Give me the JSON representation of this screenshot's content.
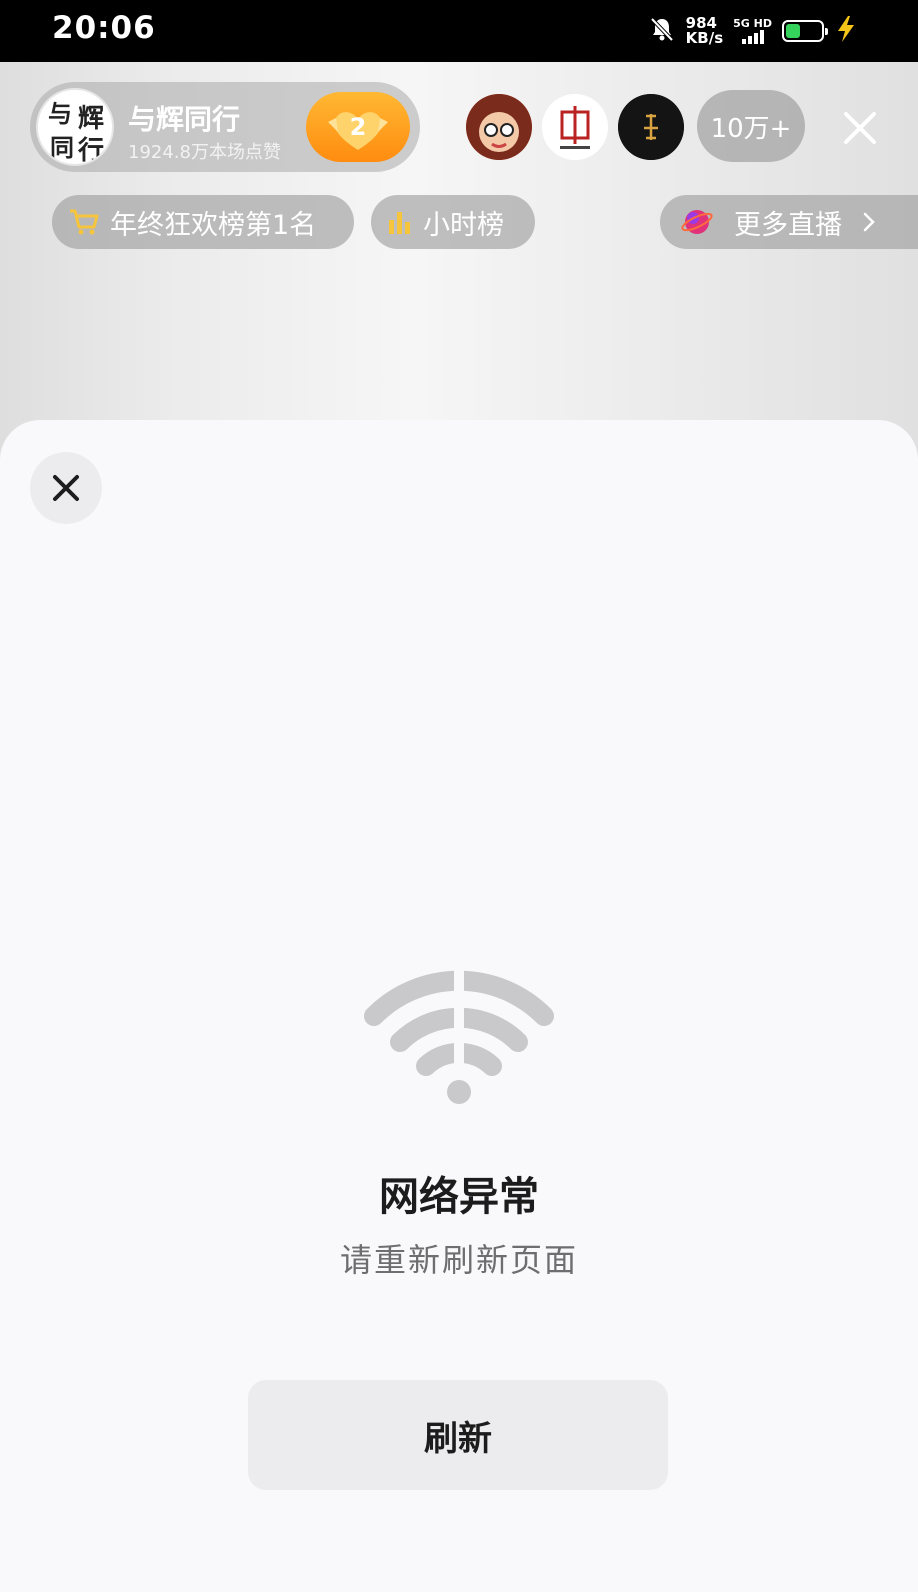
{
  "status_bar": {
    "time": "20:06",
    "net_speed_value": "984",
    "net_speed_unit": "KB/s",
    "signal_label": "5G HD",
    "battery_level": 0.4,
    "battery_color": "#35d35c"
  },
  "live_header": {
    "host": {
      "avatar_text": [
        "与",
        "辉",
        "同",
        "行"
      ],
      "name": "与辉同行",
      "likes": "1924.8万本场点赞",
      "follow_badge_level": "2",
      "badge_color": "#ff9a1f"
    },
    "viewer_count": "10万+",
    "chips": {
      "rank": "年终狂欢榜第1名",
      "hourly": "小时榜",
      "more_live": "更多直播"
    }
  },
  "sheet": {
    "title": "网络异常",
    "subtitle": "请重新刷新页面",
    "refresh_label": "刷新"
  },
  "icons": [
    "bell-off-icon",
    "cart-icon",
    "bar-chart-icon",
    "planet-icon",
    "chevron-right-icon",
    "close-icon",
    "wifi-icon"
  ]
}
